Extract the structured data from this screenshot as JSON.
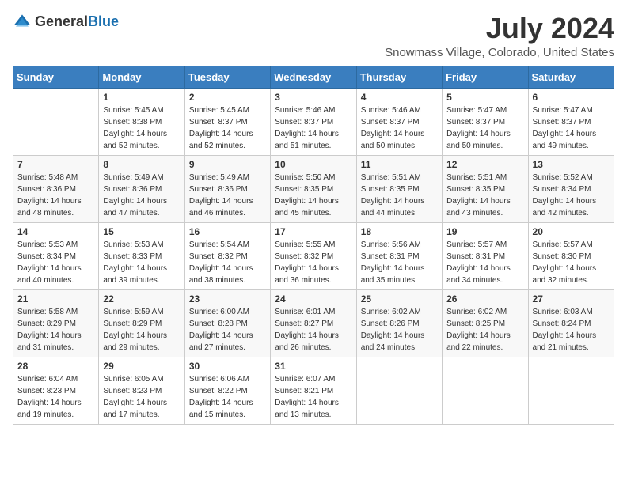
{
  "header": {
    "logo_general": "General",
    "logo_blue": "Blue",
    "title": "July 2024",
    "subtitle": "Snowmass Village, Colorado, United States"
  },
  "calendar": {
    "days_of_week": [
      "Sunday",
      "Monday",
      "Tuesday",
      "Wednesday",
      "Thursday",
      "Friday",
      "Saturday"
    ],
    "weeks": [
      [
        {
          "day": "",
          "info": ""
        },
        {
          "day": "1",
          "info": "Sunrise: 5:45 AM\nSunset: 8:38 PM\nDaylight: 14 hours\nand 52 minutes."
        },
        {
          "day": "2",
          "info": "Sunrise: 5:45 AM\nSunset: 8:37 PM\nDaylight: 14 hours\nand 52 minutes."
        },
        {
          "day": "3",
          "info": "Sunrise: 5:46 AM\nSunset: 8:37 PM\nDaylight: 14 hours\nand 51 minutes."
        },
        {
          "day": "4",
          "info": "Sunrise: 5:46 AM\nSunset: 8:37 PM\nDaylight: 14 hours\nand 50 minutes."
        },
        {
          "day": "5",
          "info": "Sunrise: 5:47 AM\nSunset: 8:37 PM\nDaylight: 14 hours\nand 50 minutes."
        },
        {
          "day": "6",
          "info": "Sunrise: 5:47 AM\nSunset: 8:37 PM\nDaylight: 14 hours\nand 49 minutes."
        }
      ],
      [
        {
          "day": "7",
          "info": "Sunrise: 5:48 AM\nSunset: 8:36 PM\nDaylight: 14 hours\nand 48 minutes."
        },
        {
          "day": "8",
          "info": "Sunrise: 5:49 AM\nSunset: 8:36 PM\nDaylight: 14 hours\nand 47 minutes."
        },
        {
          "day": "9",
          "info": "Sunrise: 5:49 AM\nSunset: 8:36 PM\nDaylight: 14 hours\nand 46 minutes."
        },
        {
          "day": "10",
          "info": "Sunrise: 5:50 AM\nSunset: 8:35 PM\nDaylight: 14 hours\nand 45 minutes."
        },
        {
          "day": "11",
          "info": "Sunrise: 5:51 AM\nSunset: 8:35 PM\nDaylight: 14 hours\nand 44 minutes."
        },
        {
          "day": "12",
          "info": "Sunrise: 5:51 AM\nSunset: 8:35 PM\nDaylight: 14 hours\nand 43 minutes."
        },
        {
          "day": "13",
          "info": "Sunrise: 5:52 AM\nSunset: 8:34 PM\nDaylight: 14 hours\nand 42 minutes."
        }
      ],
      [
        {
          "day": "14",
          "info": "Sunrise: 5:53 AM\nSunset: 8:34 PM\nDaylight: 14 hours\nand 40 minutes."
        },
        {
          "day": "15",
          "info": "Sunrise: 5:53 AM\nSunset: 8:33 PM\nDaylight: 14 hours\nand 39 minutes."
        },
        {
          "day": "16",
          "info": "Sunrise: 5:54 AM\nSunset: 8:32 PM\nDaylight: 14 hours\nand 38 minutes."
        },
        {
          "day": "17",
          "info": "Sunrise: 5:55 AM\nSunset: 8:32 PM\nDaylight: 14 hours\nand 36 minutes."
        },
        {
          "day": "18",
          "info": "Sunrise: 5:56 AM\nSunset: 8:31 PM\nDaylight: 14 hours\nand 35 minutes."
        },
        {
          "day": "19",
          "info": "Sunrise: 5:57 AM\nSunset: 8:31 PM\nDaylight: 14 hours\nand 34 minutes."
        },
        {
          "day": "20",
          "info": "Sunrise: 5:57 AM\nSunset: 8:30 PM\nDaylight: 14 hours\nand 32 minutes."
        }
      ],
      [
        {
          "day": "21",
          "info": "Sunrise: 5:58 AM\nSunset: 8:29 PM\nDaylight: 14 hours\nand 31 minutes."
        },
        {
          "day": "22",
          "info": "Sunrise: 5:59 AM\nSunset: 8:29 PM\nDaylight: 14 hours\nand 29 minutes."
        },
        {
          "day": "23",
          "info": "Sunrise: 6:00 AM\nSunset: 8:28 PM\nDaylight: 14 hours\nand 27 minutes."
        },
        {
          "day": "24",
          "info": "Sunrise: 6:01 AM\nSunset: 8:27 PM\nDaylight: 14 hours\nand 26 minutes."
        },
        {
          "day": "25",
          "info": "Sunrise: 6:02 AM\nSunset: 8:26 PM\nDaylight: 14 hours\nand 24 minutes."
        },
        {
          "day": "26",
          "info": "Sunrise: 6:02 AM\nSunset: 8:25 PM\nDaylight: 14 hours\nand 22 minutes."
        },
        {
          "day": "27",
          "info": "Sunrise: 6:03 AM\nSunset: 8:24 PM\nDaylight: 14 hours\nand 21 minutes."
        }
      ],
      [
        {
          "day": "28",
          "info": "Sunrise: 6:04 AM\nSunset: 8:23 PM\nDaylight: 14 hours\nand 19 minutes."
        },
        {
          "day": "29",
          "info": "Sunrise: 6:05 AM\nSunset: 8:23 PM\nDaylight: 14 hours\nand 17 minutes."
        },
        {
          "day": "30",
          "info": "Sunrise: 6:06 AM\nSunset: 8:22 PM\nDaylight: 14 hours\nand 15 minutes."
        },
        {
          "day": "31",
          "info": "Sunrise: 6:07 AM\nSunset: 8:21 PM\nDaylight: 14 hours\nand 13 minutes."
        },
        {
          "day": "",
          "info": ""
        },
        {
          "day": "",
          "info": ""
        },
        {
          "day": "",
          "info": ""
        }
      ]
    ]
  }
}
